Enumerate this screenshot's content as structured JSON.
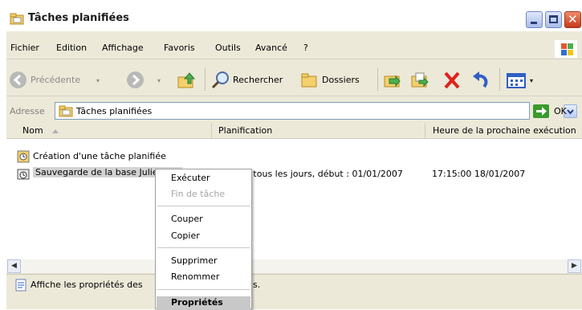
{
  "window": {
    "title": "Tâches planifiées"
  },
  "menubar": {
    "items": [
      "Fichier",
      "Edition",
      "Affichage",
      "Favoris",
      "Outils",
      "Avancé",
      "?"
    ]
  },
  "toolbar": {
    "back_label": "Précédente",
    "search_label": "Rechercher",
    "folders_label": "Dossiers"
  },
  "address": {
    "label": "Adresse",
    "value": "Tâches planifiées",
    "go_label": "OK"
  },
  "list": {
    "columns": [
      "Nom",
      "Planification",
      "Heure de la prochaine exécution"
    ],
    "rows": [
      {
        "name": "Création d'une tâche planifiée",
        "schedule": "",
        "next_run": ""
      },
      {
        "name": "Sauvegarde de la base Julie SMS",
        "schedule": "à 17:15 tous les jours, début : 01/01/2007",
        "next_run": "17:15:00  18/01/2007"
      }
    ]
  },
  "status": {
    "text": "Affiche les propriétés des",
    "text_tail": "s."
  },
  "context_menu": {
    "items": [
      "Exécuter",
      "Fin de tâche",
      "Couper",
      "Copier",
      "Supprimer",
      "Renommer",
      "Propriétés"
    ],
    "disabled": [
      "Fin de tâche"
    ],
    "default": "Propriétés"
  },
  "colors": {
    "title_bar": "#ffffff",
    "chrome": "#ece9d8",
    "close_button": "#d2451e",
    "go_arrow": "#3a9a2c"
  }
}
